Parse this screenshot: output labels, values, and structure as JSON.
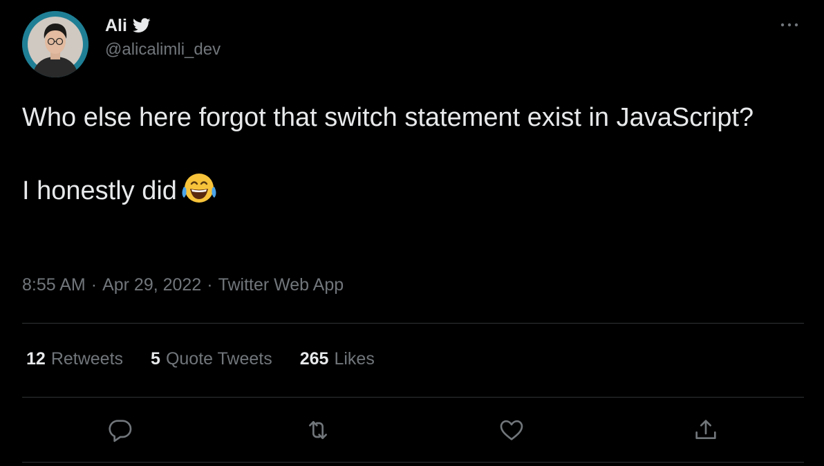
{
  "author": {
    "display_name": "Ali",
    "handle": "@alicalimli_dev",
    "avatar_icon": "avatar-photo",
    "verified_icon": "twitter-bird-icon"
  },
  "tweet": {
    "line1": "Who else here forgot that switch statement exist in JavaScript?",
    "line2": "I honestly did",
    "emoji": "😂"
  },
  "meta": {
    "time": "8:55 AM",
    "separator": "·",
    "date": "Apr 29, 2022",
    "source": "Twitter Web App"
  },
  "stats": {
    "retweets_count": "12",
    "retweets_label": "Retweets",
    "quote_count": "5",
    "quote_label": "Quote Tweets",
    "likes_count": "265",
    "likes_label": "Likes"
  },
  "actions": [
    {
      "icon": "reply-icon"
    },
    {
      "icon": "retweet-icon"
    },
    {
      "icon": "like-icon"
    },
    {
      "icon": "share-icon"
    }
  ],
  "colors": {
    "background": "#000000",
    "primary_text": "#e7e9ea",
    "secondary_text": "#71767b",
    "divider": "#2f3336",
    "avatar_ring": "#1f7f95"
  }
}
